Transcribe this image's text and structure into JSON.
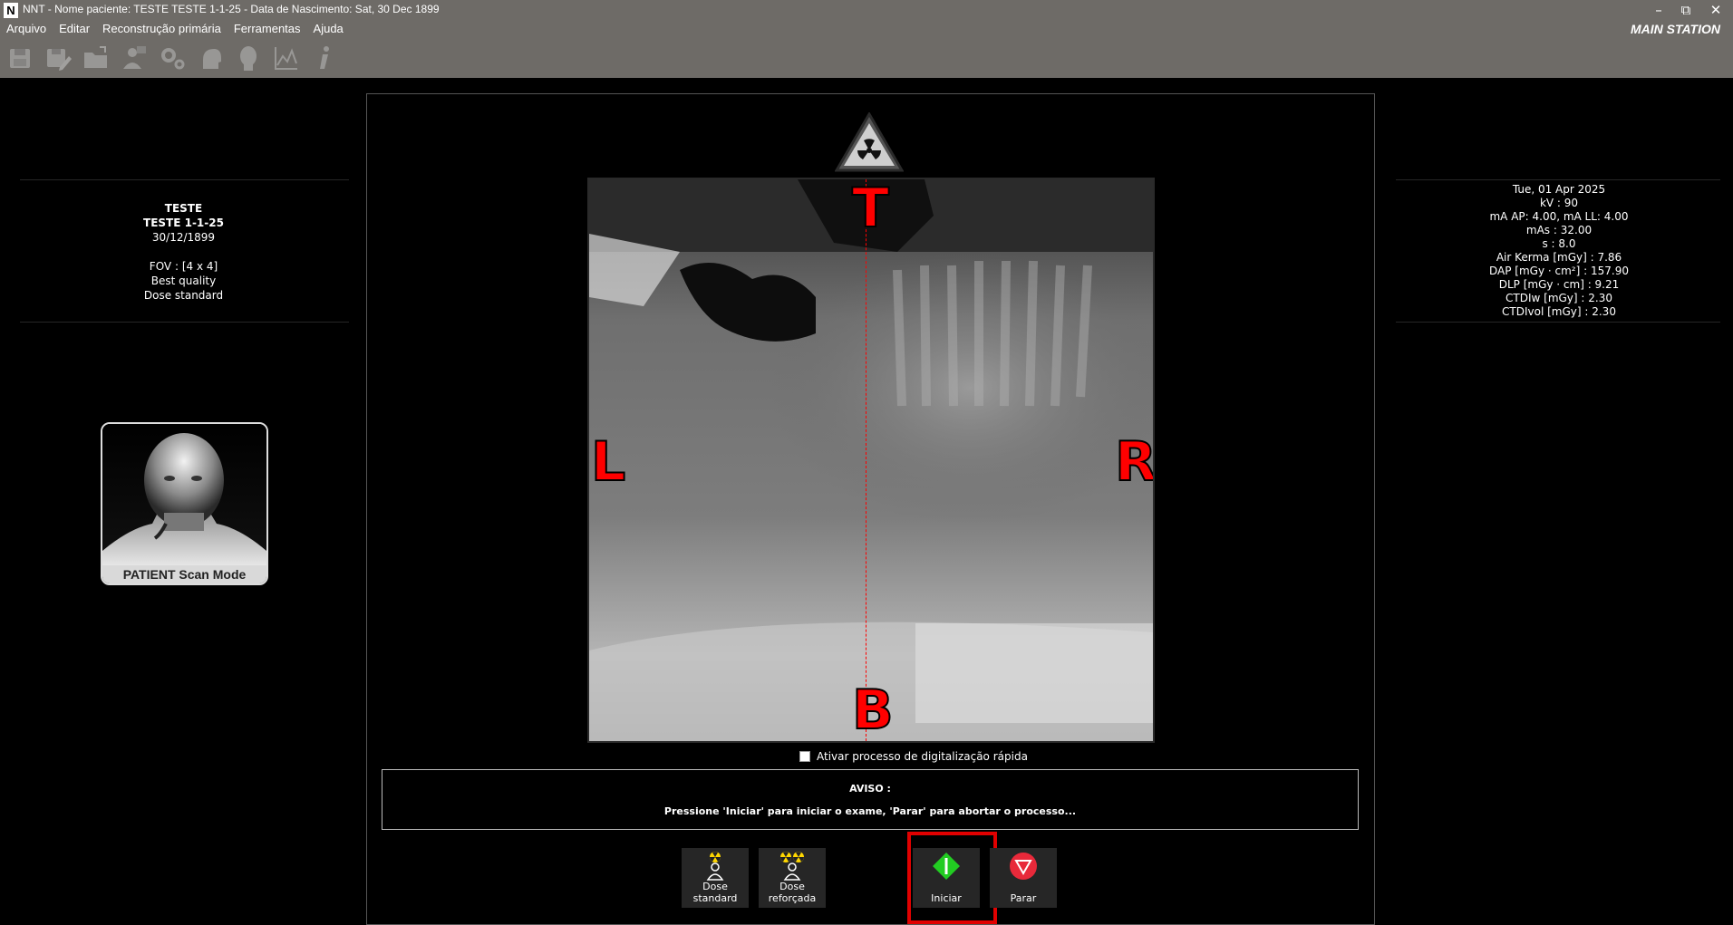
{
  "window": {
    "logo": "N",
    "title": "NNT - Nome paciente: TESTE TESTE 1-1-25 - Data de Nascimento: Sat, 30 Dec 1899",
    "station": "MAIN STATION",
    "controls": {
      "minimize": "–",
      "restore": "⧉",
      "close": "✕"
    }
  },
  "menu": {
    "items": [
      "Arquivo",
      "Editar",
      "Reconstrução primária",
      "Ferramentas",
      "Ajuda"
    ]
  },
  "toolbar": {
    "icons": [
      "save-icon",
      "save-as-icon",
      "open-folder-icon",
      "patient-settings-icon",
      "device-settings-icon",
      "head-side-icon",
      "head-front-icon",
      "chart-icon",
      "info-icon"
    ]
  },
  "patient": {
    "name": "TESTE",
    "full_name": "TESTE 1-1-25",
    "birth_date": "30/12/1899",
    "fov": "FOV : [4 x 4]",
    "quality": "Best quality",
    "dose": "Dose standard"
  },
  "scan_mode": {
    "caption": "PATIENT Scan Mode"
  },
  "exposure": {
    "date": "Tue, 01 Apr 2025",
    "kv": "kV : 90",
    "ma": "mA AP: 4.00, mA LL: 4.00",
    "mas": "mAs : 32.00",
    "s": "s : 8.0",
    "air_kerma": "Air Kerma [mGy] : 7.86",
    "dap": "DAP [mGy · cm²] : 157.90",
    "dlp": "DLP [mGy · cm] : 9.21",
    "ctdiw": "CTDIw [mGy] : 2.30",
    "ctdivol": "CTDIvol [mGy] : 2.30"
  },
  "image": {
    "top_label": "T",
    "bottom_label": "B",
    "left_label": "L",
    "right_label": "R"
  },
  "fast_scan": {
    "label": "Ativar processo de digitalização rápida",
    "checked": false
  },
  "notice": {
    "title": "AVISO :",
    "message": "Pressione 'Iniciar' para iniciar o exame, 'Parar' para abortar o processo..."
  },
  "actions": {
    "dose_standard": "Dose\nstandard",
    "dose_standard_line1": "Dose",
    "dose_standard_line2": "standard",
    "dose_reinforced_line1": "Dose",
    "dose_reinforced_line2": "reforçada",
    "start": "Iniciar",
    "stop": "Parar"
  },
  "colors": {
    "chrome": "#6e6b67",
    "background": "#000000",
    "orientation": "#ff0000",
    "start": "#22cc22",
    "stop": "#e8293a",
    "highlight": "#e10000",
    "radiation": "#ffd700"
  }
}
